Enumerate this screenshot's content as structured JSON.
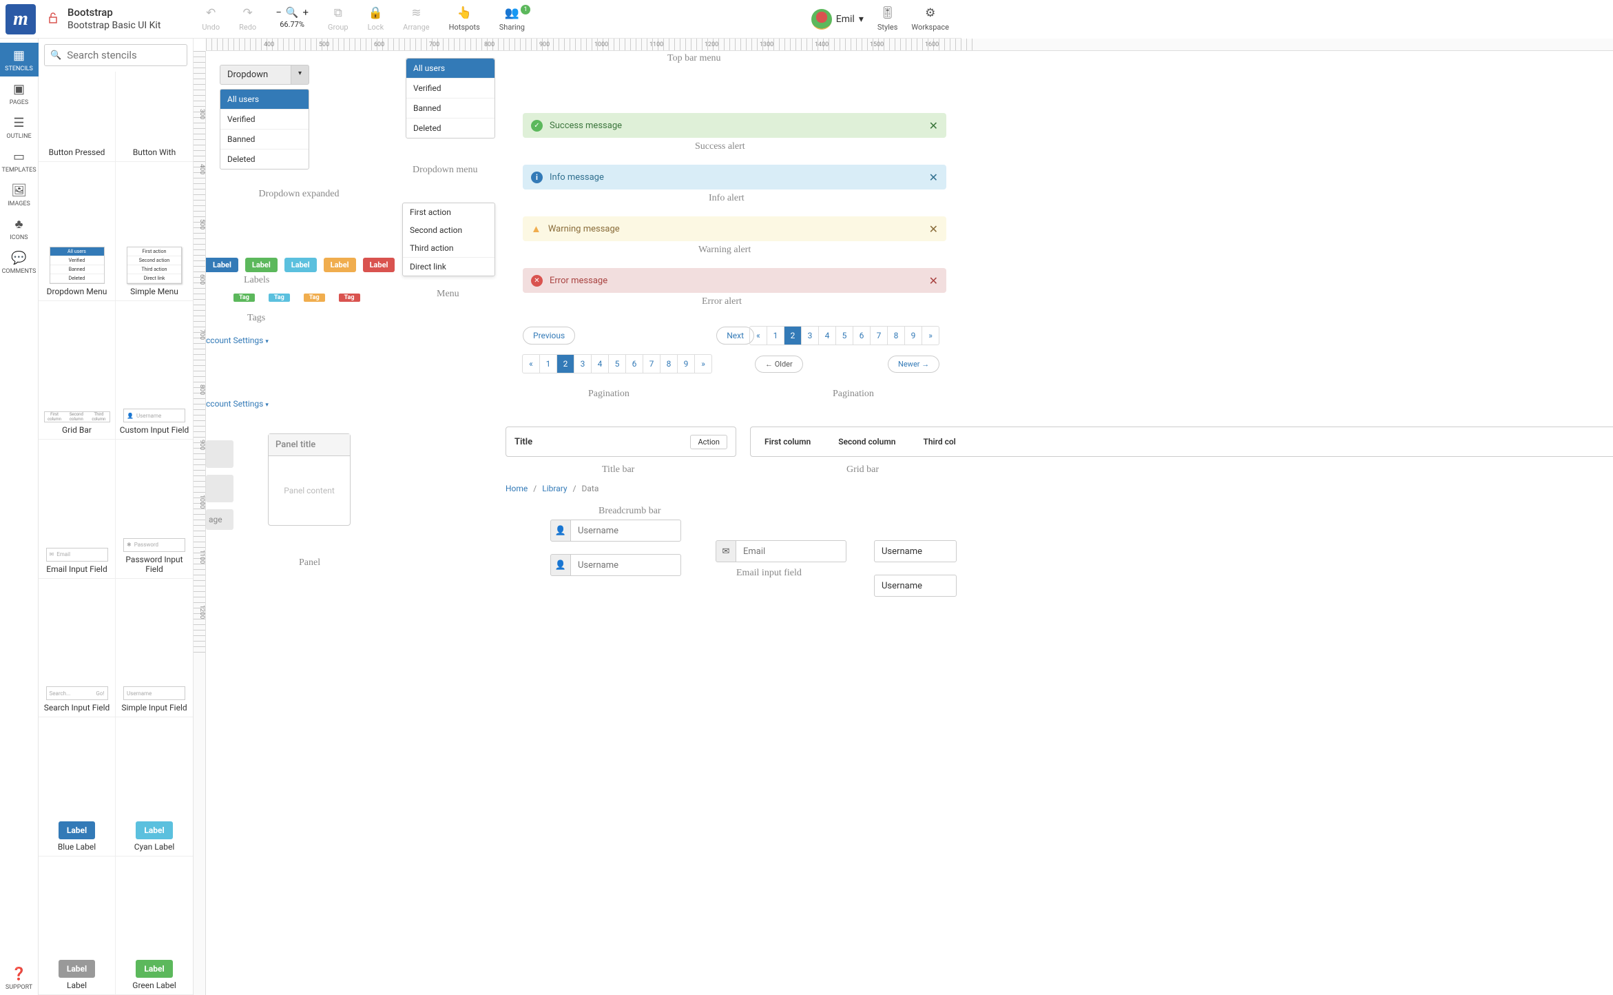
{
  "topbar": {
    "logo": "m",
    "project_title": "Bootstrap",
    "project_subtitle": "Bootstrap Basic UI Kit",
    "undo": "Undo",
    "redo": "Redo",
    "zoom": "66.77%",
    "group": "Group",
    "lock": "Lock",
    "arrange": "Arrange",
    "hotspots": "Hotspots",
    "sharing": "Sharing",
    "sharing_badge": "1",
    "user": "Emil",
    "styles": "Styles",
    "workspace": "Workspace"
  },
  "rail": {
    "stencils": "STENCILS",
    "pages": "PAGES",
    "outline": "OUTLINE",
    "templates": "TEMPLATES",
    "images": "IMAGES",
    "icons": "ICONS",
    "comments": "COMMENTS",
    "support": "SUPPORT"
  },
  "stencil_search_placeholder": "Search stencils",
  "stencil_items": {
    "btn_pressed": "Button Pressed",
    "btn_with": "Button With",
    "dropdown_menu": "Dropdown Menu",
    "simple_menu": "Simple Menu",
    "grid_bar": "Grid Bar",
    "custom_input": "Custom Input Field",
    "email_input": "Email Input Field",
    "password_input": "Password Input Field",
    "search_input": "Search Input Field",
    "simple_input": "Simple Input Field",
    "blue_label": "Blue Label",
    "cyan_label": "Cyan Label",
    "label": "Label",
    "green_label": "Green Label"
  },
  "stencil_thumbs": {
    "dd_h": "All users",
    "dd1": "Verified",
    "dd2": "Banned",
    "dd3": "Deleted",
    "sm1": "First action",
    "sm2": "Second action",
    "sm3": "Third action",
    "sm4": "Direct link",
    "grid1": "First column",
    "grid2": "Second column",
    "grid3": "Third column",
    "user_ph": "Username",
    "email_ph": "Email",
    "pass_ph": "Password",
    "search_ph": "Search...",
    "go": "Go!",
    "label_txt": "Label"
  },
  "ruler_h": [
    "",
    "400",
    "500",
    "600",
    "700",
    "800",
    "900",
    "1000",
    "1100",
    "1200",
    "1300",
    "1400",
    "1500",
    "1600"
  ],
  "ruler_v": [
    "",
    "300",
    "400",
    "500",
    "600",
    "700",
    "800",
    "900",
    "1000",
    "1100",
    "1200"
  ],
  "canvas": {
    "dropdown": {
      "header": "Dropdown",
      "sel": "All users",
      "i1": "Verified",
      "i2": "Banned",
      "i3": "Deleted"
    },
    "cap_dd_exp": "Dropdown expanded",
    "ddmenu": {
      "sel": "All users",
      "i1": "Verified",
      "i2": "Banned",
      "i3": "Deleted"
    },
    "cap_dd_menu": "Dropdown menu",
    "smenu": {
      "i1": "First action",
      "i2": "Second action",
      "i3": "Third action",
      "i4": "Direct link"
    },
    "cap_menu": "Menu",
    "labels_cap": "Labels",
    "label_txt": "Label",
    "tags_cap": "Tags",
    "tag_txt": "Tag",
    "acct": "ccount Settings",
    "panel_title": "Panel title",
    "panel_body": "Panel content",
    "cap_panel": "Panel",
    "gray_txt": "age",
    "cap_topbar": "Top bar menu",
    "alert_success": "Success message",
    "cap_success": "Success alert",
    "alert_info": "Info message",
    "cap_info": "Info alert",
    "alert_warn": "Warning message",
    "cap_warn": "Warning alert",
    "alert_err": "Error message",
    "cap_err": "Error alert",
    "prev": "Previous",
    "next": "Next",
    "older": "Older",
    "newer": "Newer",
    "cap_pag": "Pagination",
    "pnums": [
      "«",
      "1",
      "2",
      "3",
      "4",
      "5",
      "6",
      "7",
      "8",
      "9",
      "»"
    ],
    "titlebar": "Title",
    "titlebar_action": "Action",
    "cap_titlebar": "Title bar",
    "gridbar": [
      "First column",
      "Second column",
      "Third col"
    ],
    "cap_gridbar": "Grid bar",
    "bc_home": "Home",
    "bc_lib": "Library",
    "bc_data": "Data",
    "cap_bc": "Breadcrumb bar",
    "username": "Username",
    "email": "Email",
    "cap_email": "Email input field"
  }
}
